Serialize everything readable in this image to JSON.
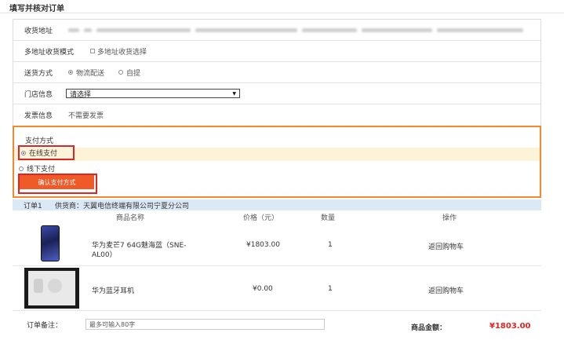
{
  "page": {
    "title": "填写并核对订单"
  },
  "form": {
    "address": {
      "label": "收货地址"
    },
    "multi_address": {
      "label": "多地址收货模式",
      "option": "多地址收货选择"
    },
    "delivery": {
      "label": "送货方式",
      "options": [
        "物流配送",
        "自提"
      ],
      "selected": "物流配送"
    },
    "store": {
      "label": "门店信息",
      "selected": "请选择"
    },
    "invoice": {
      "label": "发票信息",
      "value": "不需要发票"
    }
  },
  "payment": {
    "title": "支付方式",
    "online": "在线支付",
    "offline": "线下支付",
    "confirm_label": "确认支付方式",
    "selected": "在线支付"
  },
  "order": {
    "label": "订单1",
    "supplier": "供货商：天翼电信终端有限公司宁夏分公司",
    "columns": [
      "商品名称",
      "价格（元）",
      "数量",
      "操作"
    ],
    "items": [
      {
        "name_line1": "华为麦芒7 64G魅海蓝（SNE-",
        "name_line2": "AL00）",
        "price": "¥1803.00",
        "qty": "1",
        "action": "返回购物车",
        "thumb_icon": "phone-image"
      },
      {
        "name_line1": "华为蓝牙耳机",
        "name_line2": "",
        "price": "¥0.00",
        "qty": "1",
        "action": "返回购物车",
        "thumb_icon": "earphone-box-image"
      }
    ],
    "remark_label": "订单备注：",
    "remark_placeholder": "最多可输入80字",
    "amount_label": "商品金额：",
    "amount_value": "¥1803.00"
  },
  "colors": {
    "accent_orange": "#f08a2c",
    "highlight_red": "#e02424",
    "button": "#f05a28",
    "link": "#2a6ad0",
    "order_head_bg": "#dbe9f6"
  }
}
